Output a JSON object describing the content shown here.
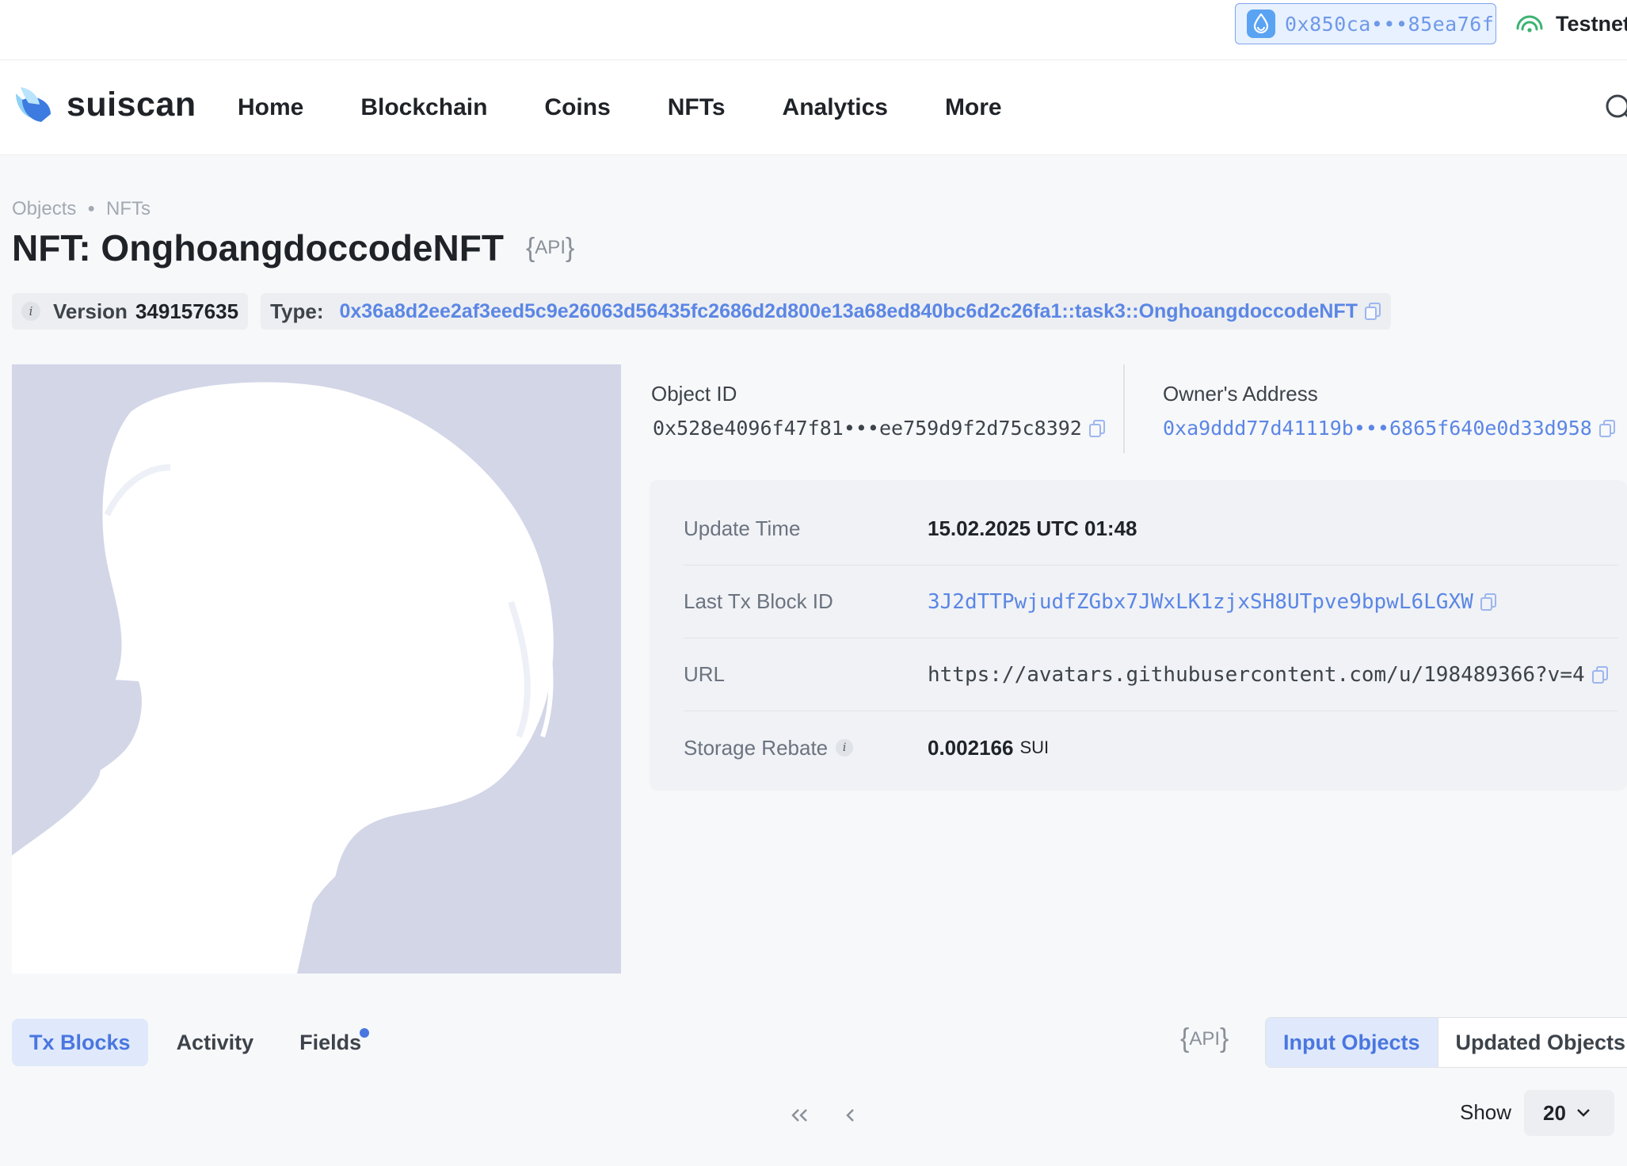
{
  "wallet": {
    "address": "0x850ca•••85ea76f"
  },
  "network": {
    "label": "Testnet"
  },
  "brand": {
    "name": "suiscan"
  },
  "nav": {
    "items": [
      {
        "label": "Home"
      },
      {
        "label": "Blockchain"
      },
      {
        "label": "Coins"
      },
      {
        "label": "NFTs"
      },
      {
        "label": "Analytics"
      },
      {
        "label": "More"
      }
    ]
  },
  "breadcrumb": {
    "items": [
      "Objects",
      "NFTs"
    ]
  },
  "page": {
    "title": "NFT: OnghoangdoccodeNFT",
    "api_label": "API"
  },
  "meta": {
    "version_label": "Version",
    "version_value": "349157635",
    "type_label": "Type:",
    "type_value": "0x36a8d2ee2af3eed5c9e26063d56435fc2686d2d800e13a68ed840bc6d2c26fa1::task3::OnghoangdoccodeNFT"
  },
  "object": {
    "id_label": "Object ID",
    "id_value": "0x528e4096f47f81•••ee759d9f2d75c8392",
    "owner_label": "Owner's Address",
    "owner_value": "0xa9ddd77d41119b•••6865f640e0d33d958"
  },
  "details": {
    "update_time_label": "Update Time",
    "update_time_value": "15.02.2025 UTC 01:48",
    "last_tx_label": "Last Tx Block ID",
    "last_tx_value": "3J2dTTPwjudfZGbx7JWxLK1zjxSH8UTpve9bpwL6LGXW",
    "url_label": "URL",
    "url_value": "https://avatars.githubusercontent.com/u/198489366?v=4",
    "storage_rebate_label": "Storage Rebate",
    "storage_rebate_value": "0.002166",
    "storage_rebate_unit": "SUI"
  },
  "tabs": {
    "items": [
      {
        "label": "Tx Blocks",
        "active": true
      },
      {
        "label": "Activity",
        "active": false
      },
      {
        "label": "Fields",
        "active": false
      }
    ],
    "api_label": "API",
    "segment": [
      {
        "label": "Input Objects",
        "active": true
      },
      {
        "label": "Updated Objects",
        "active": false
      }
    ]
  },
  "pagination": {
    "show_label": "Show",
    "page_size": "20"
  },
  "colors": {
    "accent": "#5b86e5",
    "image_bg": "#d3d6e7",
    "network_green": "#3cb371"
  }
}
